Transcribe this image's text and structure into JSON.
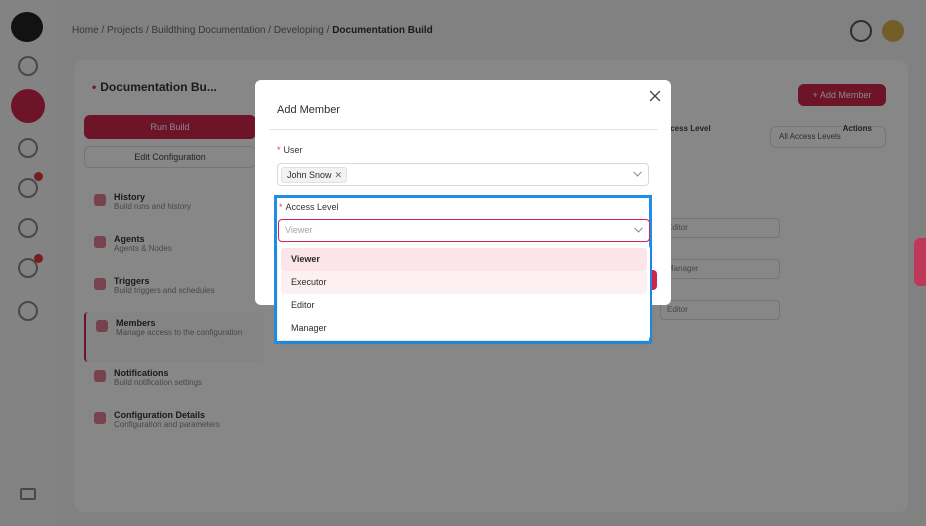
{
  "breadcrumb": {
    "home": "Home",
    "items": [
      "Projects",
      "Buildthing Documentation",
      "Developing"
    ],
    "current": "Documentation Build",
    "separator": "/"
  },
  "page": {
    "title": "Documentation Bu...",
    "add_member_button": "+ Add Member",
    "run_build_button": "Run Build",
    "edit_config_button": "Edit Configuration",
    "filter_select": "All Access Levels"
  },
  "side_menu": [
    {
      "title": "History",
      "subtitle": "Build runs and history"
    },
    {
      "title": "Agents",
      "subtitle": "Agents & Nodes"
    },
    {
      "title": "Triggers",
      "subtitle": "Build triggers and schedules"
    },
    {
      "title": "Members",
      "subtitle": "Manage access to the configuration"
    },
    {
      "title": "Notifications",
      "subtitle": "Build notification settings"
    },
    {
      "title": "Configuration Details",
      "subtitle": "Configuration and parameters"
    }
  ],
  "table": {
    "col_access": "Access Level",
    "col_actions": "Actions",
    "rows": [
      "Editor",
      "Manager",
      "Editor"
    ]
  },
  "modal": {
    "title": "Add Member",
    "user_label": "User",
    "user_tag": "John Snow",
    "access_label": "Access Level",
    "access_placeholder": "Viewer",
    "options": [
      "Viewer",
      "Executor",
      "Editor",
      "Manager"
    ],
    "selected_option": "Viewer"
  },
  "colors": {
    "accent": "#d0264f",
    "highlight_border": "#1f8ee6",
    "selected_option_bg": "#fbe4ea"
  },
  "icons": {
    "close": "close-icon",
    "chevron": "chevron-down-icon",
    "tag_remove": "remove-tag-icon"
  }
}
